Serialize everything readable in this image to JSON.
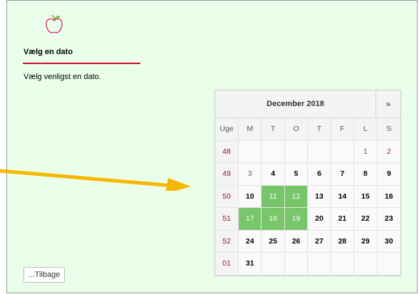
{
  "page": {
    "title": "Vælg en dato",
    "prompt": "Vælg venligst en dato.",
    "back_label": "...Tilbage",
    "accent_color": "#c8102e",
    "background_color": "#eaffea",
    "logo_icon": "apple-outline-icon"
  },
  "calendar": {
    "month_label": "December 2018",
    "next_label": "»",
    "week_header": "Uge",
    "weekday_headers": [
      "M",
      "T",
      "O",
      "T",
      "F",
      "L",
      "S"
    ],
    "highlight_color": "#77c66a",
    "weeks": [
      {
        "week": "48",
        "days": [
          "",
          "",
          "",
          "",
          "",
          "1",
          "2"
        ]
      },
      {
        "week": "49",
        "days": [
          "3",
          "4",
          "5",
          "6",
          "7",
          "8",
          "9"
        ]
      },
      {
        "week": "50",
        "days": [
          "10",
          "11",
          "12",
          "13",
          "14",
          "15",
          "16"
        ]
      },
      {
        "week": "51",
        "days": [
          "17",
          "18",
          "19",
          "20",
          "21",
          "22",
          "23"
        ]
      },
      {
        "week": "52",
        "days": [
          "24",
          "25",
          "26",
          "27",
          "28",
          "29",
          "30"
        ]
      },
      {
        "week": "01",
        "days": [
          "31",
          "",
          "",
          "",
          "",
          "",
          ""
        ]
      }
    ],
    "past_days": [
      "1",
      "2",
      "3"
    ],
    "highlighted_days": [
      "11",
      "12",
      "17",
      "18",
      "19"
    ]
  }
}
